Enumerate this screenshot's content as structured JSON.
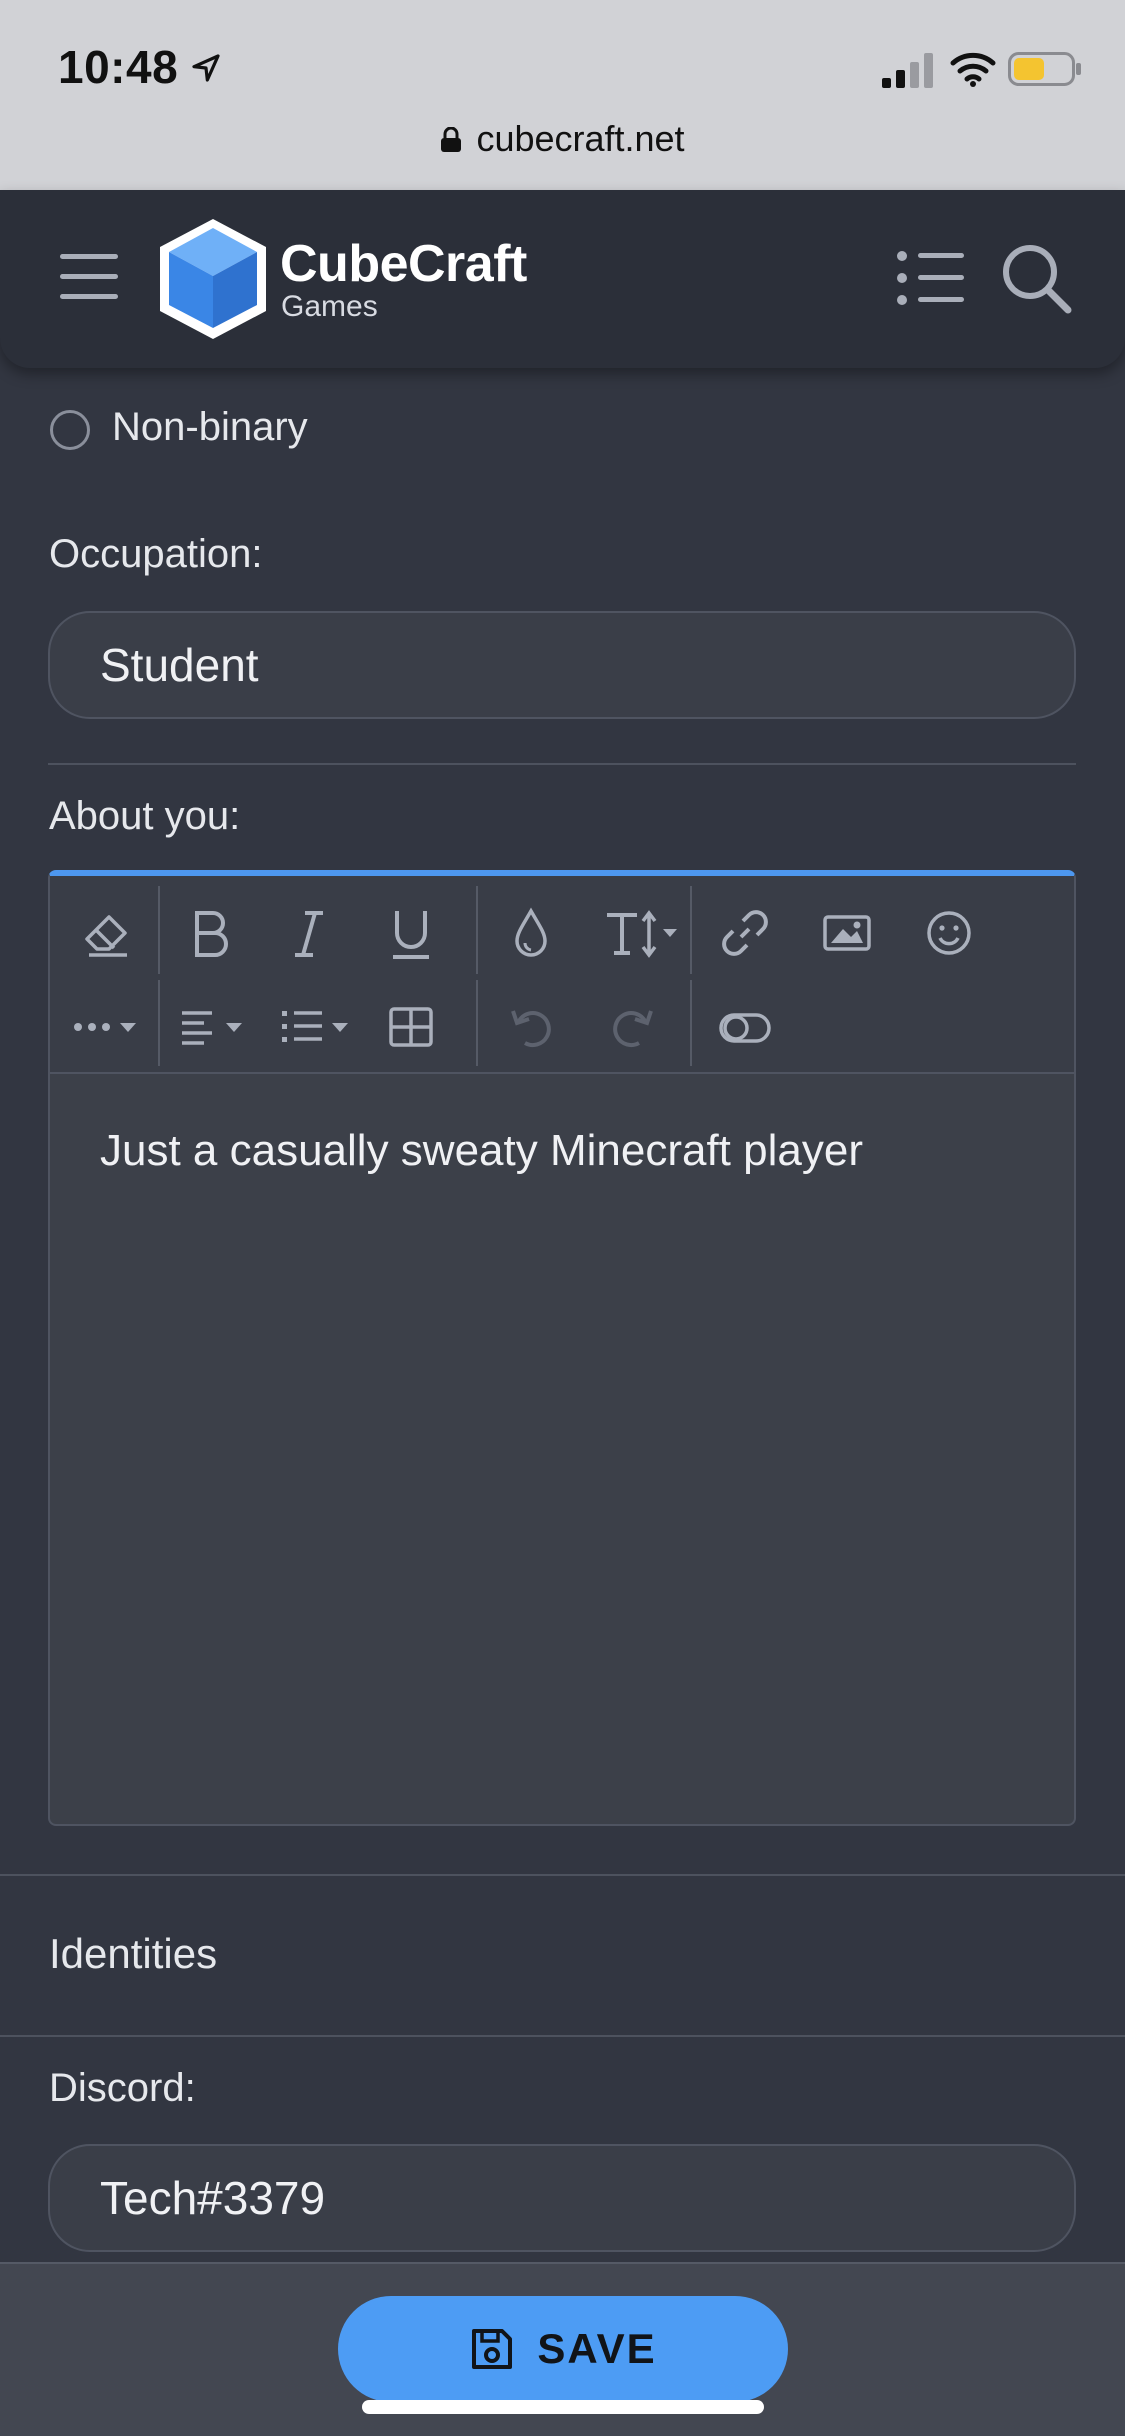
{
  "status": {
    "time": "10:48",
    "url": "cubecraft.net"
  },
  "header": {
    "logo_title": "CubeCraft",
    "logo_sub": "Games"
  },
  "form": {
    "radio_option": "Non-binary",
    "occupation_label": "Occupation:",
    "occupation_value": "Student",
    "about_label": "About you:",
    "about_text": "Just a casually sweaty Minecraft player",
    "identities_title": "Identities",
    "discord_label": "Discord:",
    "discord_value": "Tech#3379"
  },
  "actions": {
    "save_label": "SAVE"
  },
  "colors": {
    "accent": "#4d9cf4",
    "background": "#323641",
    "header": "#2b2f39",
    "editor_top_border": "#4d97ef"
  },
  "icons": [
    "location-arrow-icon",
    "signal-icon",
    "wifi-icon",
    "battery-icon",
    "lock-icon",
    "hamburger-menu-icon",
    "cubecraft-logo-icon",
    "list-icon",
    "search-icon",
    "eraser-icon",
    "bold-icon",
    "italic-icon",
    "underline-icon",
    "color-drop-icon",
    "font-size-icon",
    "link-icon",
    "image-icon",
    "smiley-icon",
    "more-icon",
    "align-icon",
    "list-format-icon",
    "table-icon",
    "undo-icon",
    "redo-icon",
    "toggle-icon",
    "save-icon"
  ]
}
